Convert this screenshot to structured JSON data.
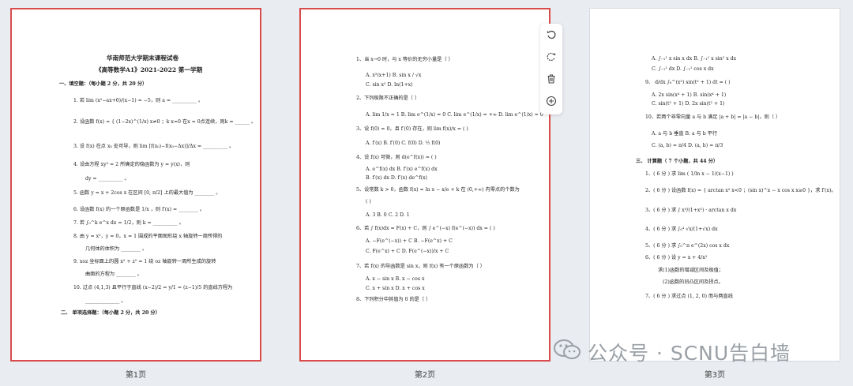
{
  "pages": {
    "p1": {
      "label": "第1页",
      "title1": "华南师范大学期末课程试卷",
      "title2": "《高等数学A1》2021-2022 第一学期",
      "sec1": "一、填空题：（每小题 2 分，共 20 分）",
      "q1": "1.    若 lim (x²−ax+6)/(x−1) = −5，则 a = __________ 。",
      "q2a": "2.    设函数 f(x) = { (1−2x)^(1/x)  x≠0 ；k  x=0  在x = 0点连续，则k = ______ 。",
      "q3": "3.    设 f(x) 在点 x₀ 处可导，则 lim [f(x₀)−f(x₀−Δx)]/Δx = __________ 。",
      "q4a": "4.    设由方程 xy² = 2 所确定的隐函数为 y = y(x)，则",
      "q4b": "dy = __________ 。",
      "q5": "5.    函数 y = x + 2cos x 在区间 [0, π/2] 上的最大值为 ________ 。",
      "q6": "6.    设函数 f(x) 的一个原函数是 1/x ，则 f′(x) = ________ 。",
      "q7": "7.    若 ∫₀^k e^x dx = 1/2，则 k = __________ 。",
      "q8a": "8.    由 y = x²，y = 0，x = 1 围成的平面图形绕 x 轴旋转一周所得的",
      "q8b": "几何体的体积为 ________ 。",
      "q9a": "9.    xoz 坐标面上的圆 x² + z² = 1 绕 oz 轴旋转一周所生成的旋转",
      "q9b": "曲面的方程为 ________ 。",
      "q10a": "10.   过点 (4,1,3) 且平行于直线 (x−2)/2 = y/1 = (z−1)/5 的直线方程为",
      "q10b": "______________ 。",
      "sec2": "二、   单项选择题：（每小题 2 分，共 20 分）"
    },
    "p2": {
      "label": "第2页",
      "l01": "1、当 x→0 时，与 x 等价的无穷小量是（       ）",
      "l02": "A.  x²(x+1)     B.  sin x / √x",
      "l03": "C.  sin x²        D.  ln(1+x)",
      "l04": "2、下列极限不正确的是（       ）",
      "l05": "A.  lim 1/x = 1    B.  lim e^(1/x) = 0    C.  lim e^(1/x) = +∞    D.  lim e^(1/x) = 0",
      "l06": "3、设 f(0) = 0，且 f′(0) 存在，则 lim f(x)/x = (       )",
      "l07": "A.  f′(x)       B.  f′(0)       C.  f(0)       D.  ½ f(0)",
      "l08": "4、设 f(x) 可微，则 d(e^f(x)) = (       )",
      "l09": "A.  e^f(x) dx          B.  f′(x) e^f(x) dx",
      "l10": "B.  f′(x) dx          D.  f′(x) de^f(x)",
      "l11": "5、设常数 k > 0，函数 f(x) = ln x − x/e + k 在 (0,+∞) 内零点的个数为",
      "l12": "(       )",
      "l13": "A.   3         B.   0         C.   2         D.   1",
      "l14": "6、若 ∫ f(x)dx = F(x) + C，则 ∫ e^(−x) f(e^(−x)) dx = (       )",
      "l15": "A.  −F(e^(−x)) + C         B.  −F(e^x) + C",
      "l16": "C.  F(e^x) + C              D.  F(e^(−x))/x + C",
      "l17": "7、若 f(x) 的导函数是 sin x，则 f(x) 有一个原函数为（        ）",
      "l18": "A.  x − sin x              B.  x − cos x",
      "l19": "C.  x + sin x              D.  x + cos x",
      "l20": "8、下列积分中其值为 0 的是（        ）"
    },
    "p3": {
      "label": "第3页",
      "l01": "A.  ∫₋₁¹ x sin x dx            B.  ∫₋₁¹ x sin² x dx",
      "l02": "C.  ∫₋₁¹ dx                      D.  ∫₋₁¹ cos x dx",
      "l03": "9、 d/dx ∫₀^(x²) sin(t² + 1) dt = (       )",
      "l04": "A.  2x sin(x⁴ + 1)             B.  sin(x⁴ + 1)",
      "l05": "C.  sin(t² + 1)                 D.  2x sin(t² + 1)",
      "l06": "10、若两个非零向量 a 与 b 满足 |a + b| = |a − b|，则（        ）",
      "l07": "A.  a 与 b 垂直                 B.  a 与 b 平行",
      "l08": "C.  (a, b) = π/4                 D.  (a, b) = π/3",
      "l09": "三、   计算题（ 7 个小题，共 44 分）",
      "l10": "1、( 6 分 ) 求 lim ( 1/ln x − 1/(x−1) )",
      "l11": "2、( 6 分 ) 设函数 f(x) = { arctan x²  x<0 ；(sin x)^x − x cos x  x≥0 }，求 f′(x)。",
      "l12": "3、( 6 分 ) 求 ∫ x³/(1+x²) · arctan x dx",
      "l13": "4、( 6 分 ) 求 ∫₀⁴ √x/(1+√x) dx",
      "l14": "5、( 6 分 ) 求 ∫₀^π e^(2x) cos x dx",
      "l15": "6、( 6 分 ) 设 y = x + 4/x²",
      "l16": "求(1)函数的增减区间及极值；",
      "l17": "(2)函数的凹凸区间及拐点。",
      "l18": "7、( 6 分 ) 求过点 (1, 2, 0) 而与两直线"
    }
  },
  "toolbar": {
    "rotate_left": "rotate-left-icon",
    "rotate_right": "rotate-right-icon",
    "delete": "trash-icon",
    "add": "add-icon"
  },
  "watermark": {
    "text": "公众号 · SCNU告白墙"
  },
  "colors": {
    "selected_border": "#d94c4c",
    "background": "#e9ecf1"
  }
}
